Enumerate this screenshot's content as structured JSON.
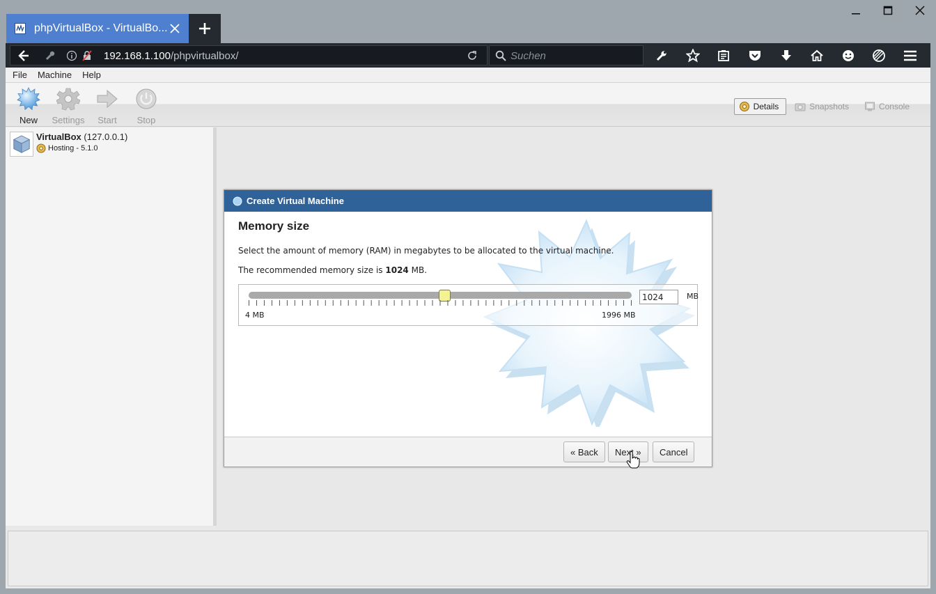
{
  "browser": {
    "tab_title": "phpVirtualBox - VirtualBo...",
    "url_host": "192.168.1.100",
    "url_path": "/phpvirtualbox/",
    "search_placeholder": "Suchen"
  },
  "menu": {
    "items": [
      "File",
      "Machine",
      "Help"
    ]
  },
  "toolbar": {
    "new_label": "New",
    "settings_label": "Settings",
    "start_label": "Start",
    "stop_label": "Stop"
  },
  "view_tabs": {
    "details": "Details",
    "snapshots": "Snapshots",
    "console": "Console"
  },
  "sidebar": {
    "host_name": "VirtualBox",
    "host_address": "(127.0.0.1)",
    "host_status": "Hosting - 5.1.0"
  },
  "dialog": {
    "title": "Create Virtual Machine",
    "heading": "Memory size",
    "description": "Select the amount of memory (RAM) in megabytes to be allocated to the virtual machine.",
    "recommended_prefix": "The recommended memory size is",
    "recommended_value": "1024",
    "recommended_suffix": "MB.",
    "slider": {
      "min": 4,
      "max": 1996,
      "value": 1024,
      "min_label": "4 MB",
      "max_label": "1996 MB"
    },
    "memory_value": "1024",
    "memory_unit": "MB",
    "back_label": "« Back",
    "next_label": "Next »",
    "cancel_label": "Cancel"
  },
  "colors": {
    "tab_active": "#4f7fcf",
    "browser_chrome": "#252a30",
    "dialog_title_bar": "#2e6299",
    "slider_thumb": "#f4f391"
  }
}
